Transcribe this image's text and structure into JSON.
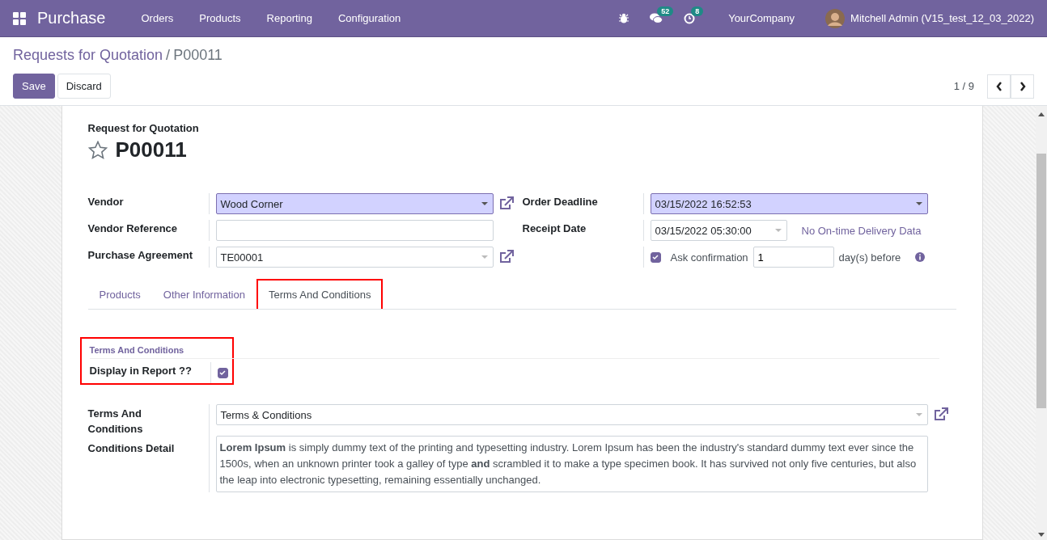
{
  "navbar": {
    "app": "Purchase",
    "menus": [
      "Orders",
      "Products",
      "Reporting",
      "Configuration"
    ],
    "badges": [
      {
        "kind": "messages",
        "count": "52"
      },
      {
        "kind": "activities",
        "count": "8"
      }
    ],
    "company": "YourCompany",
    "user": "Mitchell Admin (V15_test_12_03_2022)"
  },
  "breadcrumb": {
    "parent": "Requests for Quotation",
    "separator": "/",
    "current": "P00011"
  },
  "buttons": [
    {
      "label": "Save",
      "kind": "primary"
    },
    {
      "label": "Discard",
      "kind": "secondary"
    }
  ],
  "pager": "1 / 9",
  "form": {
    "subtitle": "Request for Quotation",
    "title": "P00011",
    "starred": false,
    "left_fields": [
      {
        "label": "Vendor",
        "kind": "many2one",
        "value": "Wood Corner",
        "required": true,
        "link": true
      },
      {
        "label": "Vendor Reference",
        "kind": "text"
      },
      {
        "label": "Purchase Agreement",
        "kind": "many2one",
        "value": "TE00001",
        "required": false,
        "link": true
      }
    ],
    "right_fields": [
      {
        "label": "Order Deadline",
        "kind": "date",
        "value": "03/15/2022 16:52:53",
        "required": true
      },
      {
        "label": "Receipt Date",
        "kind": "date_note",
        "value": "03/15/2022 05:30:00",
        "required": false,
        "note": "No On-time Delivery Data"
      },
      {
        "kind": "confirm",
        "checked": true,
        "text": "Ask confirmation",
        "value": "1",
        "suffix": "day(s) before"
      }
    ],
    "tabs": [
      {
        "label": "Products",
        "selected": false,
        "highlighted": false
      },
      {
        "label": "Other Information",
        "selected": false,
        "highlighted": false
      },
      {
        "label": "Terms And Conditions",
        "selected": true,
        "highlighted": true
      }
    ],
    "section": {
      "title": "Terms And Conditions",
      "highlighted": true,
      "field": {
        "label": "Display in Report ??",
        "checked": true
      }
    },
    "terms": {
      "labels": [
        "Terms And Conditions",
        "Conditions Detail"
      ],
      "value": "Terms & Conditions",
      "detail": "**Lorem Ipsum** is simply dummy text of the printing and typesetting industry. Lorem Ipsum has been the industry's standard dummy text ever since the 1500s, when an unknown printer took a galley of type **and** scrambled it to make a type specimen book. It has survived not only five centuries, but also the leap into electronic typesetting, remaining essentially unchanged."
    }
  }
}
